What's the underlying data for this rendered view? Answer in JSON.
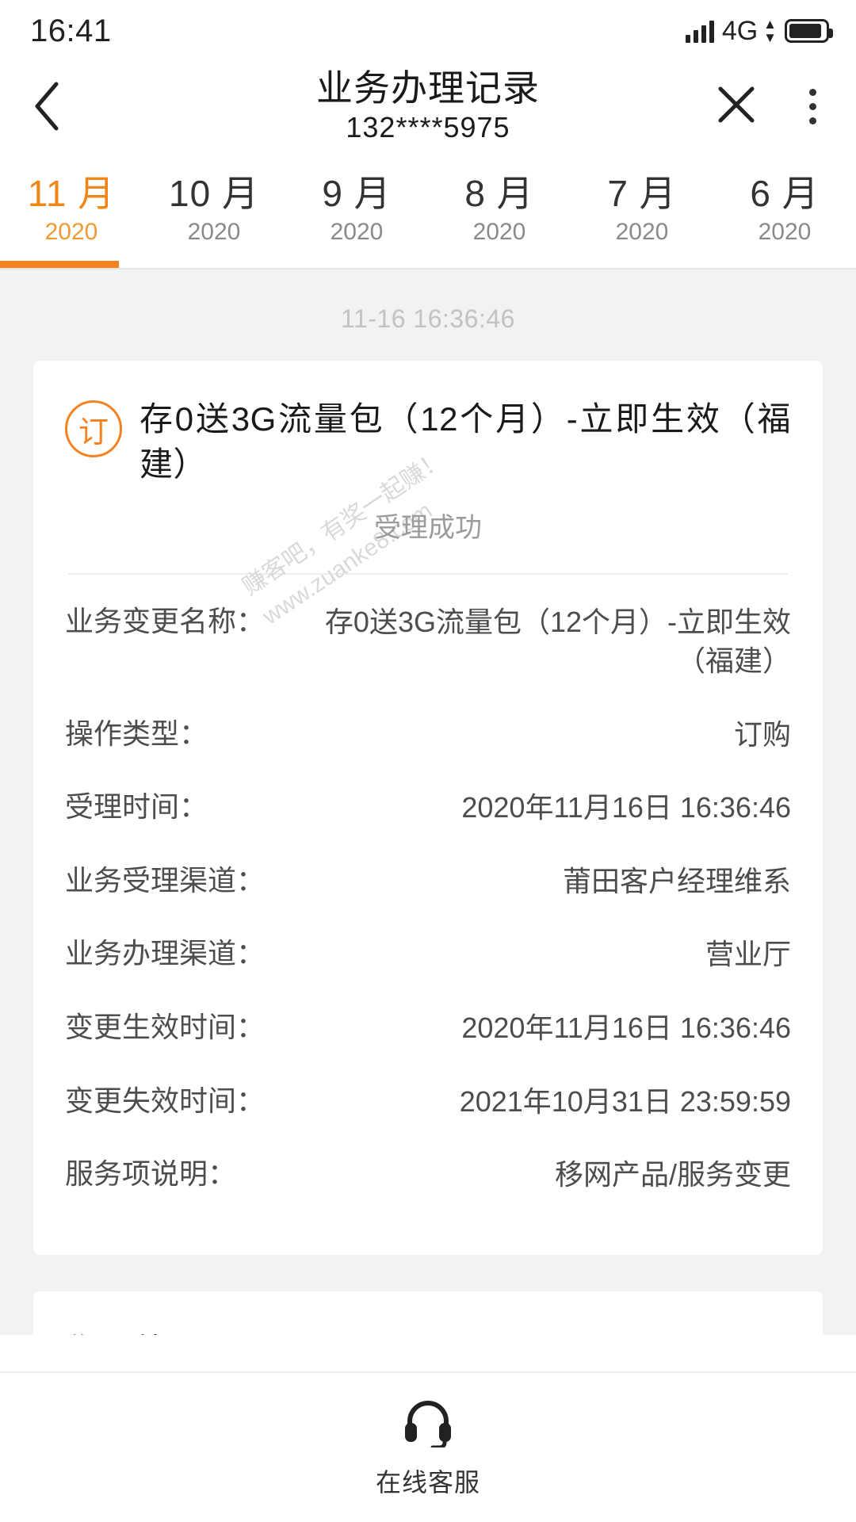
{
  "status_bar": {
    "time": "16:41",
    "network": "4G",
    "signal_icon": "signal-bars-icon",
    "data_arrows_icon": "data-transfer-icon",
    "battery_icon": "battery-full-icon"
  },
  "nav": {
    "back_icon": "back-chevron-icon",
    "title": "业务办理记录",
    "subtitle": "132****5975",
    "close_icon": "close-icon",
    "more_icon": "more-vertical-icon"
  },
  "tabs": {
    "active_index": 0,
    "items": [
      {
        "month": "11 月",
        "year": "2020"
      },
      {
        "month": "10 月",
        "year": "2020"
      },
      {
        "month": "9 月",
        "year": "2020"
      },
      {
        "month": "8 月",
        "year": "2020"
      },
      {
        "month": "7 月",
        "year": "2020"
      },
      {
        "month": "6 月",
        "year": "2020"
      }
    ]
  },
  "record": {
    "timestamp": "11-16 16:36:46",
    "badge_text": "订",
    "title": "存0送3G流量包（12个月）-立即生效（福建）",
    "status": "受理成功",
    "details": [
      {
        "label": "业务变更名称：",
        "value": "存0送3G流量包（12个月）-立即生效（福建）"
      },
      {
        "label": "操作类型：",
        "value": "订购"
      },
      {
        "label": "受理时间：",
        "value": "2020年11月16日 16:36:46"
      },
      {
        "label": "业务受理渠道：",
        "value": "莆田客户经理维系"
      },
      {
        "label": "业务办理渠道：",
        "value": "营业厅"
      },
      {
        "label": "变更生效时间：",
        "value": "2020年11月16日 16:36:46"
      },
      {
        "label": "变更失效时间：",
        "value": "2021年10月31日 23:59:59"
      },
      {
        "label": "服务项说明：",
        "value": "移网产品/服务变更"
      }
    ]
  },
  "watermark": {
    "line1": "赚客吧，有奖一起赚！",
    "line2": "www.zuanke8.com"
  },
  "next_section": {
    "title": "你可能需要"
  },
  "bottom_bar": {
    "icon": "headset-icon",
    "label": "在线客服"
  },
  "colors": {
    "accent": "#f58220",
    "accent_text": "#f08518",
    "page_bg": "#f2f2f2",
    "card_bg": "#ffffff",
    "muted_text": "#9b9b9b",
    "body_text": "#4d4d4d"
  }
}
